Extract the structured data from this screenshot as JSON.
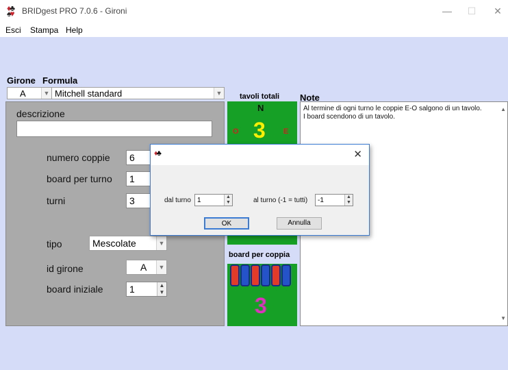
{
  "window": {
    "title": "BRIDgest PRO 7.0.6 - Gironi"
  },
  "menu": {
    "items": [
      "Esci",
      "Stampa",
      "Help"
    ]
  },
  "labels": {
    "girone": "Girone",
    "formula": "Formula",
    "tavoli_totali": "tavoli totali",
    "note": "Note",
    "board_per_coppia": "board per coppia"
  },
  "girone_combo": {
    "value": "A"
  },
  "formula_combo": {
    "value": "Mitchell standard"
  },
  "form": {
    "descrizione_label": "descrizione",
    "descrizione_value": "",
    "numero_coppie_label": "numero coppie",
    "numero_coppie_value": "6",
    "board_per_turno_label": "board per turno",
    "board_per_turno_value": "1",
    "turni_label": "turni",
    "turni_value": "3",
    "tipo_label": "tipo",
    "tipo_value": "Mescolate",
    "id_girone_label": "id girone",
    "id_girone_value": "A",
    "board_iniziale_label": "board iniziale",
    "board_iniziale_value": "1"
  },
  "tables": {
    "north": "N",
    "west": "O",
    "east": "E",
    "count": "3"
  },
  "boards_per_pair": {
    "count": "3",
    "card_colors": [
      "#e23b2a",
      "#2452c8",
      "#e23b2a",
      "#2452c8",
      "#e23b2a",
      "#2452c8"
    ]
  },
  "notes": {
    "lines": [
      "Al termine di ogni turno le coppie E-O salgono di un tavolo.",
      "I board scendono di un tavolo."
    ]
  },
  "dialog": {
    "dal_turno_label": "dal turno",
    "dal_turno_value": "1",
    "al_turno_label": "al turno (-1 = tutti)",
    "al_turno_value": "-1",
    "ok_label": "OK",
    "annulla_label": "Annulla"
  }
}
